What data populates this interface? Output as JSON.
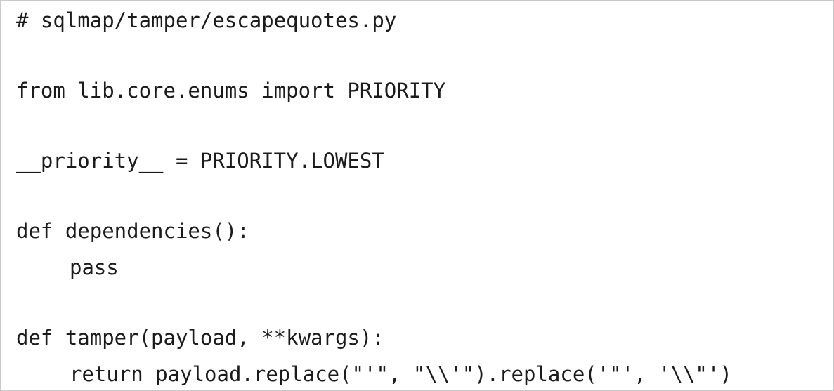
{
  "code": {
    "comment": "# sqlmap/tamper/escapequotes.py",
    "import_line": "from lib.core.enums import PRIORITY",
    "priority_line": "__priority__ = PRIORITY.LOWEST",
    "dependencies_def": "def dependencies():",
    "dependencies_body": "pass",
    "tamper_def": "def tamper(payload, **kwargs):",
    "tamper_body": "return payload.replace(\"'\", \"\\\\'\").replace('\"', '\\\\\"')"
  }
}
